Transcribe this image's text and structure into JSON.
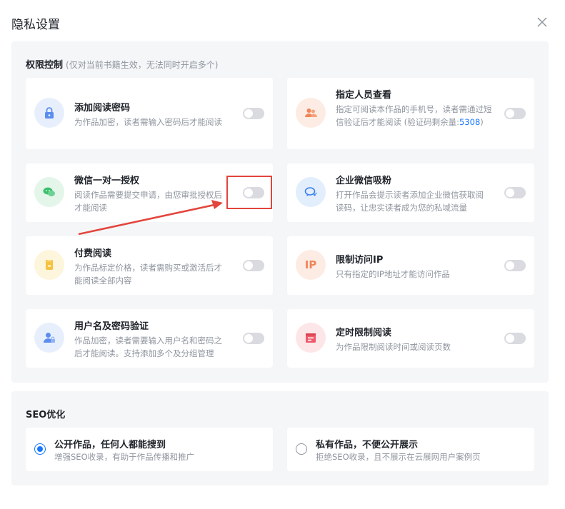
{
  "dialog": {
    "title": "隐私设置"
  },
  "permissions": {
    "title": "权限控制",
    "subtitle": "(仅对当前书籍生效，无法同时开启多个)",
    "items": [
      {
        "name": "添加阅读密码",
        "desc": "为作品加密，读者需输入密码后才能阅读",
        "icon": "lock-icon",
        "enabled": false
      },
      {
        "name": "指定人员查看",
        "desc": "指定可阅读本作品的手机号，读者需通过短信验证后才能阅读 (验证码剩余量:",
        "desc_link": "5308",
        "desc_tail": ")",
        "icon": "people-icon",
        "enabled": false
      },
      {
        "name": "微信一对一授权",
        "desc": "阅读作品需要提交申请，由您审批授权后才能阅读",
        "icon": "wechat-icon",
        "enabled": false
      },
      {
        "name": "企业微信吸粉",
        "desc": "打开作品会提示读者添加企业微信获取阅读码，让忠实读者成为您的私域流量",
        "icon": "enterprise-wechat-icon",
        "enabled": false
      },
      {
        "name": "付费阅读",
        "desc": "为作品标定价格，读者需购买或激活后才能阅读全部内容",
        "icon": "paid-reading-icon",
        "enabled": false
      },
      {
        "name": "限制访问IP",
        "desc": "只有指定的IP地址才能访问作品",
        "icon": "ip-icon",
        "icon_text": "IP",
        "enabled": false
      },
      {
        "name": "用户名及密码验证",
        "desc": "作品加密，读者需要输入用户名和密码之后才能阅读。支持添加多个及分组管理",
        "icon": "user-lock-icon",
        "enabled": false
      },
      {
        "name": "定时限制阅读",
        "desc": "为作品限制阅读时间或阅读页数",
        "icon": "calendar-icon",
        "enabled": false
      }
    ]
  },
  "seo": {
    "title": "SEO优化",
    "options": [
      {
        "name": "公开作品，任何人都能搜到",
        "desc": "增强SEO收录，有助于作品传播和推广",
        "selected": true
      },
      {
        "name": "私有作品，不便公开展示",
        "desc": "拒绝SEO收录，且不展示在云展网用户案例页",
        "selected": false
      }
    ]
  },
  "colors": {
    "accent": "#1677ff",
    "annotation": "#e2453c",
    "panel_bg": "#f5f6f8",
    "toggle_off": "#d9dbe0"
  }
}
